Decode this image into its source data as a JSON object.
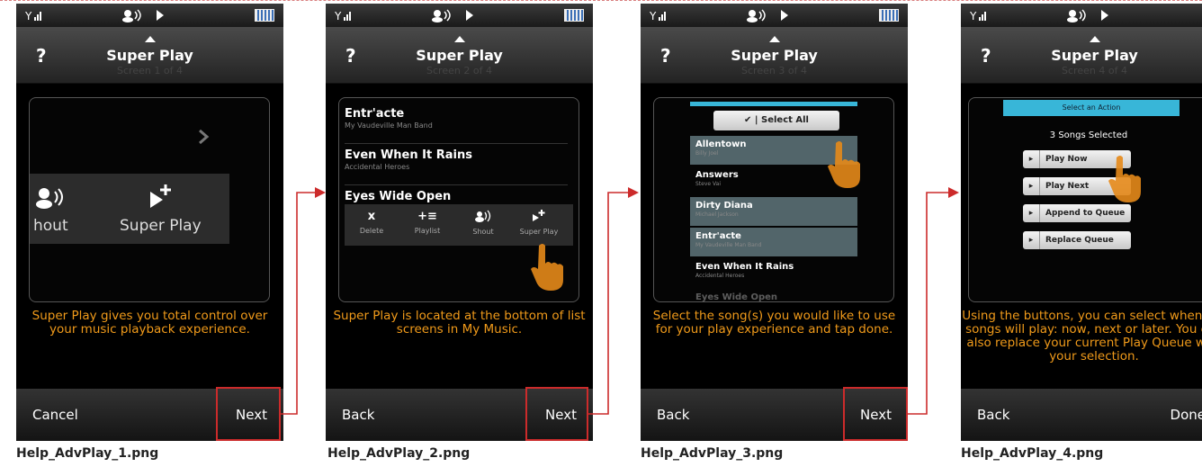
{
  "screens": [
    {
      "title": "Super Play",
      "subtitle": "Screen 1 of 4",
      "left_button": "Cancel",
      "right_button": "Next",
      "caption": "Super Play gives you total control over your music playback experience.",
      "filename": "Help_AdvPlay_1.png",
      "toolbar": {
        "shout": "hout",
        "superplay": "Super Play"
      }
    },
    {
      "title": "Super Play",
      "subtitle": "Screen 2 of 4",
      "left_button": "Back",
      "right_button": "Next",
      "caption": "Super Play is located at the bottom of list screens in My Music.",
      "filename": "Help_AdvPlay_2.png",
      "list": [
        {
          "title": "Entr'acte",
          "sub": "My Vaudeville Man Band"
        },
        {
          "title": "Even When It Rains",
          "sub": "Accidental Heroes"
        },
        {
          "title": "Eyes Wide Open",
          "sub": ""
        }
      ],
      "toolbar": [
        {
          "icon": "x",
          "label": "Delete"
        },
        {
          "icon": "+≡",
          "label": "Playlist"
        },
        {
          "icon": "shout",
          "label": "Shout"
        },
        {
          "icon": "superplay",
          "label": "Super Play"
        }
      ]
    },
    {
      "title": "Super Play",
      "subtitle": "Screen 3 of 4",
      "left_button": "Back",
      "right_button": "Next",
      "caption": "Select the song(s) you would like to use for your play experience and tap done.",
      "filename": "Help_AdvPlay_3.png",
      "select_all": "Select All",
      "songs": [
        {
          "title": "Allentown",
          "sub": "Billy Joel",
          "selected": true
        },
        {
          "title": "Answers",
          "sub": "Steve Vai",
          "selected": false
        },
        {
          "title": "Dirty Diana",
          "sub": "Michael Jackson",
          "selected": true
        },
        {
          "title": "Entr'acte",
          "sub": "My Vaudeville Man Band",
          "selected": true
        },
        {
          "title": "Even When It Rains",
          "sub": "Accidental Heroes",
          "selected": false
        },
        {
          "title": "Eyes Wide Open",
          "sub": "",
          "selected": false
        }
      ]
    },
    {
      "title": "Super Play",
      "subtitle": "Screen 4 of 4",
      "left_button": "Back",
      "right_button": "Done",
      "caption": "Using the buttons, you can select when the songs will play: now, next or later. You can also replace your current Play Queue with your selection.",
      "filename": "Help_AdvPlay_4.png",
      "header": "Select an Action",
      "selected_count": "3 Songs Selected",
      "actions": [
        "Play Now",
        "Play Next",
        "Append to Queue",
        "Replace Queue"
      ]
    }
  ],
  "colors": {
    "caption": "#f09a1a",
    "highlight_box": "#cc2b2b",
    "cyan_bar": "#38b6d8"
  }
}
